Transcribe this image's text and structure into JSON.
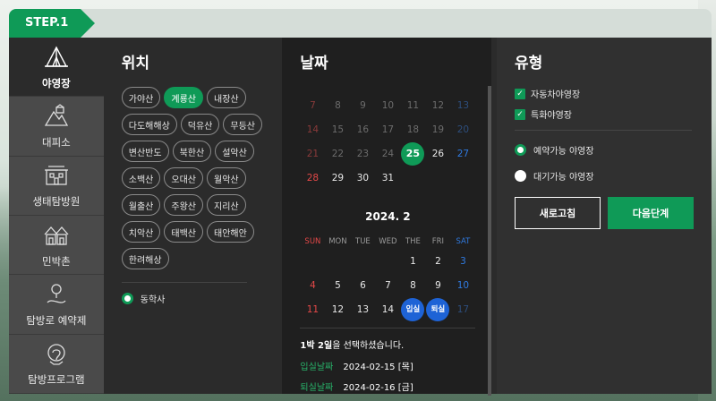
{
  "step_label": "STEP.1",
  "sidebar": {
    "items": [
      {
        "label": "야영장",
        "icon": "tent-icon",
        "active": true
      },
      {
        "label": "대피소",
        "icon": "shelter-icon",
        "active": false
      },
      {
        "label": "생태탐방원",
        "icon": "eco-center-icon",
        "active": false
      },
      {
        "label": "민박촌",
        "icon": "village-icon",
        "active": false
      },
      {
        "label": "탐방로 예약제",
        "icon": "trail-pin-icon",
        "active": false
      },
      {
        "label": "탐방프로그램",
        "icon": "program-icon",
        "active": false
      }
    ]
  },
  "location": {
    "title": "위치",
    "chips": [
      "가야산",
      "계룡산",
      "내장산",
      "다도해해상",
      "덕유산",
      "무등산",
      "변산반도",
      "북한산",
      "설악산",
      "소백산",
      "오대산",
      "월악산",
      "월출산",
      "주왕산",
      "지리산",
      "치악산",
      "태백산",
      "태안해안",
      "한려해상"
    ],
    "selected_chip": "계룡산",
    "sub_option": "동학사"
  },
  "date": {
    "title": "날짜",
    "jan_rows": [
      [
        "7",
        "8",
        "9",
        "10",
        "11",
        "12",
        "13"
      ],
      [
        "14",
        "15",
        "16",
        "17",
        "18",
        "19",
        "20"
      ],
      [
        "21",
        "22",
        "23",
        "24",
        "25",
        "26",
        "27"
      ],
      [
        "28",
        "29",
        "30",
        "31",
        "",
        "",
        ""
      ]
    ],
    "today": "25",
    "feb_month": "2024. 2",
    "weekdays": [
      "SUN",
      "MON",
      "TUE",
      "WED",
      "THE",
      "FRI",
      "SAT"
    ],
    "feb_rows": [
      [
        "",
        "",
        "",
        "",
        "1",
        "2",
        "3"
      ],
      [
        "4",
        "5",
        "6",
        "7",
        "8",
        "9",
        "10"
      ],
      [
        "11",
        "12",
        "13",
        "14",
        "입실",
        "퇴실",
        "17"
      ]
    ],
    "summary_bold": "1박 2일",
    "summary_rest": "을 선택하셨습니다.",
    "checkin_label": "입실날짜",
    "checkin_value": "2024-02-15 [목]",
    "checkout_label": "퇴실날짜",
    "checkout_value": "2024-02-16 [금]"
  },
  "type": {
    "title": "유형",
    "checkboxes": [
      "자동차야영장",
      "특화야영장"
    ],
    "radio_on": "예약가능 야영장",
    "radio_off": "대기가능 야영장",
    "refresh_label": "새로고침",
    "next_label": "다음단계"
  },
  "colors": {
    "accent": "#0f9a57",
    "selected_blue": "#1e63d6",
    "sunday": "#e44848",
    "saturday": "#2f7ae0"
  }
}
